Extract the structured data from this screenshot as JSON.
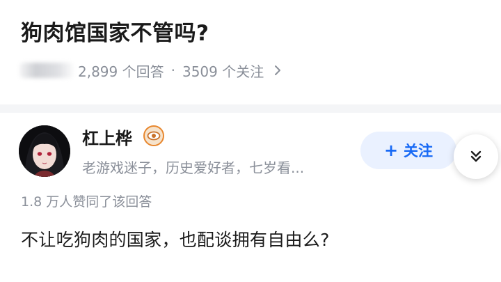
{
  "question": {
    "title": "狗肉馆国家不管吗?",
    "answers_count": "2,899 个回答",
    "separator": "·",
    "followers_count": "3509 个关注"
  },
  "answer": {
    "author_name": "杠上桦",
    "author_bio": "老游戏迷子，历史爱好者，七岁看...",
    "follow_label": "关注",
    "follow_plus": "+",
    "upvote_text": "1.8 万人赞同了该回答",
    "content": "不让吃狗肉的国家，也配谈拥有自由么?"
  },
  "colors": {
    "accent": "#1769f5",
    "follow_bg": "#eaf1ff",
    "meta_text": "#8a8f99",
    "divider": "#f4f5f7",
    "badge": "#e8872e"
  },
  "icons": {
    "meta_arrow": "chevron-right-icon",
    "badge": "eye-badge-icon",
    "expand": "double-chevron-down-icon"
  }
}
